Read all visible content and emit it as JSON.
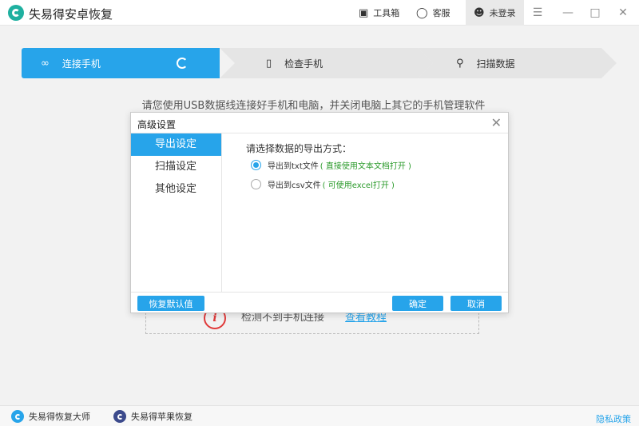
{
  "titlebar": {
    "app_title": "失易得安卓恢复",
    "toolbox_label": "工具箱",
    "service_label": "客服",
    "login_label": "未登录"
  },
  "steps": [
    {
      "label": "连接手机",
      "icon": "link-icon"
    },
    {
      "label": "检查手机",
      "icon": "phone-icon"
    },
    {
      "label": "扫描数据",
      "icon": "search-icon"
    }
  ],
  "instruction": "请您使用USB数据线连接好手机和电脑，并关闭电脑上其它的手机管理软件",
  "background_notice": {
    "message": "检测不到手机连接",
    "link": "查看教程"
  },
  "dialog": {
    "title": "高级设置",
    "sidebar": [
      "导出设定",
      "扫描设定",
      "其他设定"
    ],
    "question": "请选择数据的导出方式：",
    "options": [
      {
        "label": "导出到txt文件",
        "hint": "( 直接使用文本文档打开 )",
        "checked": true
      },
      {
        "label": "导出到csv文件",
        "hint": "( 可使用excel打开 )",
        "checked": false
      }
    ],
    "reset_label": "恢复默认值",
    "ok_label": "确定",
    "cancel_label": "取消"
  },
  "footer": {
    "item1": "失易得恢复大师",
    "item2": "失易得苹果恢复",
    "privacy": "隐私政策"
  },
  "colors": {
    "accent": "#27a4ea",
    "logo": "#1fb0a0",
    "hint_green": "#2a9a2a",
    "warning": "#e03b3b"
  }
}
